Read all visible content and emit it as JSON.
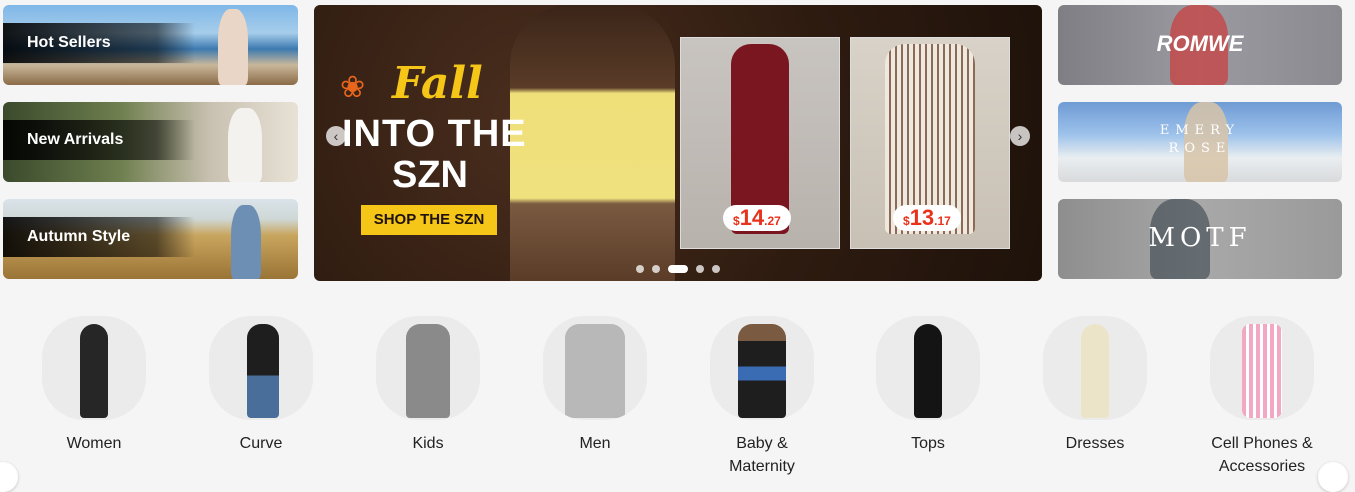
{
  "promos": [
    {
      "label": "Hot Sellers"
    },
    {
      "label": "New Arrivals"
    },
    {
      "label": "Autumn Style"
    }
  ],
  "banner": {
    "headline_script": "Fall",
    "headline_line1": "INTO THE",
    "headline_line2": "SZN",
    "cta": "SHOP THE SZN",
    "products": [
      {
        "currency": "$",
        "whole": "14",
        "cents": ".27"
      },
      {
        "currency": "$",
        "whole": "13",
        "cents": ".17"
      }
    ],
    "prev_icon": "chevron-left-icon",
    "next_icon": "chevron-right-icon",
    "slide_count": 5,
    "active_slide": 3,
    "accent_color": "#f5c518",
    "price_color": "#e8321c"
  },
  "brands": [
    {
      "name": "ROMWE"
    },
    {
      "name": "EMERY\nROSE"
    },
    {
      "name": "MOTF"
    }
  ],
  "categories": [
    {
      "label": "Women"
    },
    {
      "label": "Curve"
    },
    {
      "label": "Kids"
    },
    {
      "label": "Men"
    },
    {
      "label": "Baby &\nMaternity"
    },
    {
      "label": "Tops"
    },
    {
      "label": "Dresses"
    },
    {
      "label": "Cell Phones &\nAccessories"
    }
  ]
}
